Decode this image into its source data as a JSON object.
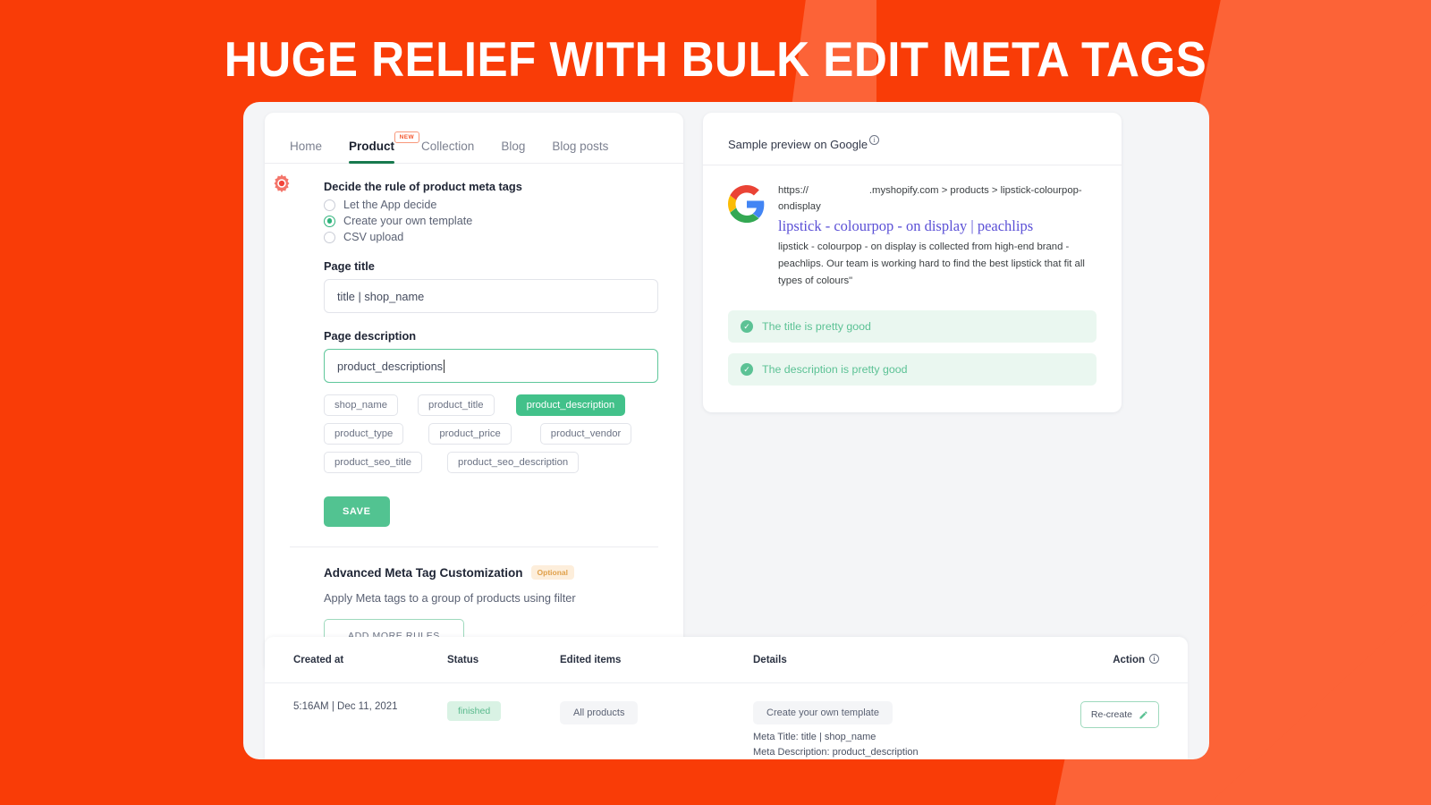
{
  "headline": "HUGE RELIEF WITH BULK EDIT META TAGS",
  "colors": {
    "background": "#f93c07",
    "background_light": "#fc6337",
    "accent_green": "#52c391",
    "accent_tab": "#18794e",
    "gear": "#f4756a",
    "badge_orange": "#e0a04a",
    "serp_link": "#5b50d6"
  },
  "tabs": [
    {
      "label": "Home",
      "active": false,
      "badge": ""
    },
    {
      "label": "Product",
      "active": true,
      "badge": "NEW"
    },
    {
      "label": "Collection",
      "active": false,
      "badge": ""
    },
    {
      "label": "Blog",
      "active": false,
      "badge": ""
    },
    {
      "label": "Blog posts",
      "active": false,
      "badge": ""
    }
  ],
  "rule": {
    "icon": "gear-icon",
    "title": "Decide the rule of product meta tags",
    "options": [
      {
        "label": "Let the App decide",
        "selected": false
      },
      {
        "label": "Create your own template",
        "selected": true
      },
      {
        "label": "CSV upload",
        "selected": false
      }
    ]
  },
  "page_title": {
    "label": "Page title",
    "value": "title | shop_name",
    "placeholder": "title | shop_name",
    "focused": false
  },
  "page_description": {
    "label": "Page description",
    "value": "product_descriptions",
    "placeholder": "product_descriptions",
    "focused": true
  },
  "chips": [
    {
      "label": "shop_name",
      "active": false
    },
    {
      "label": "product_title",
      "active": false
    },
    {
      "label": "product_description",
      "active": true
    },
    {
      "label": "product_type",
      "active": false
    },
    {
      "label": "product_price",
      "active": false
    },
    {
      "label": "product_vendor",
      "active": false
    },
    {
      "label": "product_seo_title",
      "active": false
    },
    {
      "label": "product_seo_description",
      "active": false
    }
  ],
  "save_label": "SAVE",
  "advanced": {
    "title": "Advanced Meta Tag Customization",
    "badge": "Optional",
    "subtitle": "Apply Meta tags to a group of products using filter",
    "button": "ADD MORE RULES"
  },
  "preview": {
    "heading": "Sample preview on Google",
    "info_icon": "info-icon",
    "url_prefix": "https://",
    "url_rest": ".myshopify.com > products > lipstick-colourpop-ondisplay",
    "title": "lipstick - colourpop - on display | peachlips",
    "description": "lipstick - colourpop - on display is collected from high-end brand - peachlips. Our team is working hard to find the best lipstick that fit all types of colours\"",
    "messages": [
      {
        "text": "The title is pretty good",
        "icon": "check-circle-icon"
      },
      {
        "text": "The description is pretty good",
        "icon": "check-circle-icon"
      }
    ]
  },
  "table": {
    "headers": {
      "created": "Created at",
      "status": "Status",
      "items": "Edited items",
      "details": "Details",
      "action": "Action"
    },
    "action_info_icon": "info-icon",
    "rows": [
      {
        "created": "5:16AM | Dec 11, 2021",
        "status": "finished",
        "items": "All products",
        "detail_pill": "Create your own template",
        "detail_meta_title": "Meta Title: title | shop_name",
        "detail_meta_description": "Meta Description: product_description",
        "action": "Re-create",
        "action_icon": "pencil-icon"
      }
    ]
  }
}
